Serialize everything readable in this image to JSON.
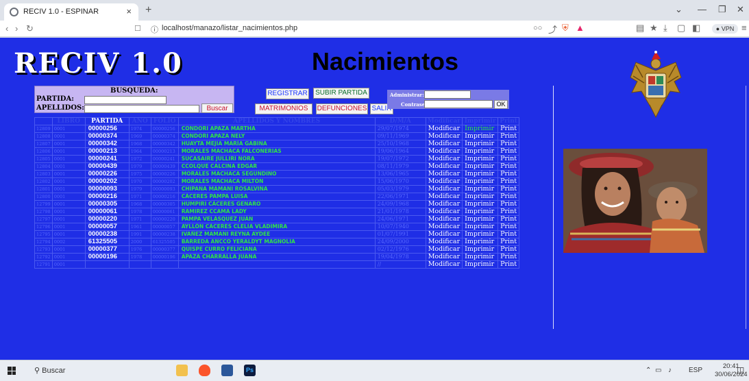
{
  "browser": {
    "tab_title": "RECIV 1.0 - ESPINAR",
    "tab_close": "×",
    "new_tab": "+",
    "url": "localhost/manazo/listar_nacimientos.php",
    "vpn_label": "● VPN"
  },
  "header": {
    "logo": "RECIV 1.0",
    "title": "Nacimientos"
  },
  "search": {
    "heading": "BUSQUEDA:",
    "partida_label": "PARTIDA:",
    "apellidos_label": "APELLIDOS:",
    "partida_value": "",
    "apellidos_value": "",
    "search_button": "Buscar"
  },
  "actions": {
    "registrar": "REGISTRAR",
    "subir_partida": "SUBIR PARTIDA",
    "matrimonios": "MATRIMONIOS",
    "defunciones": "DEFUNCIONES",
    "salir": "SALIR"
  },
  "admin": {
    "admin_label": "Administrar:",
    "password_label": "Contraseña:",
    "ok_button": "OK"
  },
  "table": {
    "headers": {
      "id": "",
      "libro": "LIBRO",
      "partida": "PARTIDA",
      "anio": "AÑO",
      "folio": "FOLIO",
      "nombre": "APELLIDOS Y NOMBRES",
      "fecha": "D/M/A",
      "modificar": "Modificar",
      "imprimir": "Imprimir",
      "print": "Print"
    },
    "rows": [
      {
        "id": "12809",
        "libro": "0001",
        "partida": "00000256",
        "anio": "1974",
        "folio": "00000256",
        "nombre": "CONDORI APAZA MARTHA",
        "fecha": "29/07/1974",
        "modificar": "Modificar",
        "imprimir": "Imprimir",
        "print": "Print"
      },
      {
        "id": "12808",
        "libro": "0001",
        "partida": "00000374",
        "anio": "1969",
        "folio": "00000374",
        "nombre": "CONDORI APAZA NELY",
        "fecha": "09/11/1969",
        "modificar": "Modificar",
        "imprimir": "Imprimir",
        "print": "Print"
      },
      {
        "id": "12807",
        "libro": "0001",
        "partida": "00000342",
        "anio": "1968",
        "folio": "00000342",
        "nombre": "HUAYTA MEJIA MARÍA GABINA",
        "fecha": "25/10/1968",
        "modificar": "Modificar",
        "imprimir": "Imprimir",
        "print": "Print"
      },
      {
        "id": "12806",
        "libro": "0001",
        "partida": "00000213",
        "anio": "1964",
        "folio": "00000213",
        "nombre": "MORALES MACHACA FALCONERIAS",
        "fecha": "19/06/1964",
        "modificar": "Modificar",
        "imprimir": "Imprimir",
        "print": "Print"
      },
      {
        "id": "12805",
        "libro": "0001",
        "partida": "00000241",
        "anio": "1972",
        "folio": "00000241",
        "nombre": "SUCASAIRE JULLIRI NORA",
        "fecha": "19/07/1972",
        "modificar": "Modificar",
        "imprimir": "Imprimir",
        "print": "Print"
      },
      {
        "id": "12804",
        "libro": "0001",
        "partida": "00000439",
        "anio": "1979",
        "folio": "00000439",
        "nombre": "CCOLQUE CALCINA EDGAR",
        "fecha": "08/11/1979",
        "modificar": "Modificar",
        "imprimir": "Imprimir",
        "print": "Print"
      },
      {
        "id": "12803",
        "libro": "0001",
        "partida": "00000226",
        "anio": "1975",
        "folio": "00000226",
        "nombre": "MORALES MACHACA SEGUNDINO",
        "fecha": "13/06/1965",
        "modificar": "Modificar",
        "imprimir": "Imprimir",
        "print": "Print"
      },
      {
        "id": "12802",
        "libro": "0001",
        "partida": "00000202",
        "anio": "1970",
        "folio": "00000202",
        "nombre": "MORALES MACHACA MILTÓN",
        "fecha": "15/06/1970",
        "modificar": "Modificar",
        "imprimir": "Imprimir",
        "print": "Print"
      },
      {
        "id": "12801",
        "libro": "0001",
        "partida": "00000093",
        "anio": "1979",
        "folio": "00000093",
        "nombre": "CHIPANA MAMANI ROSALVINA",
        "fecha": "05/03/1979",
        "modificar": "Modificar",
        "imprimir": "Imprimir",
        "print": "Print"
      },
      {
        "id": "12800",
        "libro": "0001",
        "partida": "00000216",
        "anio": "1971",
        "folio": "00000216",
        "nombre": "CÁCERES PAMPA LUISA",
        "fecha": "22/06/1971",
        "modificar": "Modificar",
        "imprimir": "Imprimir",
        "print": "Print"
      },
      {
        "id": "12799",
        "libro": "0001",
        "partida": "00000305",
        "anio": "1968",
        "folio": "00000305",
        "nombre": "HUMPIRI CÁCERES GENARO",
        "fecha": "24/09/1968",
        "modificar": "Modificar",
        "imprimir": "Imprimir",
        "print": "Print"
      },
      {
        "id": "12798",
        "libro": "0001",
        "partida": "00000061",
        "anio": "1978",
        "folio": "00000061",
        "nombre": "RAMIREZ CCAMA LADY",
        "fecha": "21/01/1978",
        "modificar": "Modificar",
        "imprimir": "Imprimir",
        "print": "Print"
      },
      {
        "id": "12797",
        "libro": "0001",
        "partida": "00000220",
        "anio": "1971",
        "folio": "00000220",
        "nombre": "PAMPA VELÁSQUEZ JUÁN",
        "fecha": "24/06/1971",
        "modificar": "Modificar",
        "imprimir": "Imprimir",
        "print": "Print"
      },
      {
        "id": "12796",
        "libro": "0001",
        "partida": "00000057",
        "anio": "1961",
        "folio": "00000057",
        "nombre": "AYLLÓN CÁCERES CLELIA VLADIMIRA",
        "fecha": "10/07/1940",
        "modificar": "Modificar",
        "imprimir": "Imprimir",
        "print": "Print"
      },
      {
        "id": "12795",
        "libro": "0001",
        "partida": "00000238",
        "anio": "1991",
        "folio": "00000238",
        "nombre": "IVAÑEZ MAMANI REYNA AYDEE",
        "fecha": "01/07/1991",
        "modificar": "Modificar",
        "imprimir": "Imprimir",
        "print": "Print"
      },
      {
        "id": "12794",
        "libro": "0002",
        "partida": "61325505",
        "anio": "2000",
        "folio": "61325505",
        "nombre": "BARREDA ANCCO YERALDYT MAGNOLIA",
        "fecha": "24/09/2000",
        "modificar": "Modificar",
        "imprimir": "Imprimir",
        "print": "Print"
      },
      {
        "id": "12793",
        "libro": "0001",
        "partida": "00000377",
        "anio": "1976",
        "folio": "00000377",
        "nombre": "QUISPE CURRO FELICIANA",
        "fecha": "02/12/1976",
        "modificar": "Modificar",
        "imprimir": "Imprimir",
        "print": "Print"
      },
      {
        "id": "12792",
        "libro": "0001",
        "partida": "00000196",
        "anio": "1978",
        "folio": "00000196",
        "nombre": "APAZA CHARRALLA JUANA",
        "fecha": "19/04/1978",
        "modificar": "Modificar",
        "imprimir": "Imprimir",
        "print": "Print"
      },
      {
        "id": "12791",
        "libro": "0001",
        "partida": "",
        "anio": "",
        "folio": "",
        "nombre": "",
        "fecha": "//",
        "modificar": "Modificar",
        "imprimir": "Imprimir",
        "print": "Print"
      }
    ]
  },
  "taskbar": {
    "search_label": "Buscar",
    "language": "ESP",
    "time": "20:41",
    "date": "30/06/2024"
  },
  "colors": {
    "page_background": "#1f2ee6",
    "name_text": "#31e34a",
    "search_panel": "#c7b6f2"
  }
}
